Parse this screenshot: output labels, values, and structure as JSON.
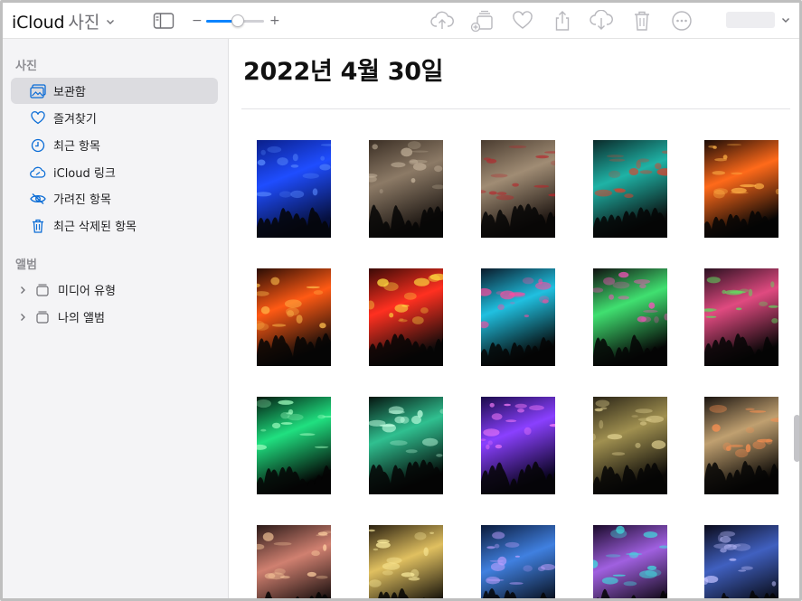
{
  "app": {
    "brand": "iCloud",
    "product": "사진"
  },
  "toolbar": {
    "zoom_minus": "−",
    "zoom_plus": "+",
    "zoom_level": 0.55,
    "icons": [
      "sidebar-toggle-icon",
      "upload-icon",
      "add-to-album-icon",
      "favorite-icon",
      "share-icon",
      "download-icon",
      "trash-icon",
      "more-icon"
    ]
  },
  "sidebar": {
    "photos_header": "사진",
    "items": [
      {
        "label": "보관함",
        "icon": "library-icon",
        "active": true
      },
      {
        "label": "즐겨찾기",
        "icon": "heart-icon",
        "active": false
      },
      {
        "label": "최근 항목",
        "icon": "clock-icon",
        "active": false
      },
      {
        "label": "iCloud 링크",
        "icon": "link-icon",
        "active": false
      },
      {
        "label": "가려진 항목",
        "icon": "eye-slash-icon",
        "active": false
      },
      {
        "label": "최근 삭제된 항목",
        "icon": "trash-icon",
        "active": false
      }
    ],
    "albums_header": "앨범",
    "albums": [
      {
        "label": "미디어 유형"
      },
      {
        "label": "나의 앨범"
      }
    ]
  },
  "main": {
    "date_title": "2022년 4월 30일",
    "photos": [
      {
        "scene": "blue-light-tunnel"
      },
      {
        "scene": "cave-interior"
      },
      {
        "scene": "cave-interior-red-seats"
      },
      {
        "scene": "cave-projection-teal-red"
      },
      {
        "scene": "cave-projection-orange-lava"
      },
      {
        "scene": "cave-projection-orange-red"
      },
      {
        "scene": "cave-projection-red-yellow"
      },
      {
        "scene": "cave-projection-colorful"
      },
      {
        "scene": "cave-projection-rainbow"
      },
      {
        "scene": "cave-projection-multicolor"
      },
      {
        "scene": "green-fireworks-projection"
      },
      {
        "scene": "green-light-lines"
      },
      {
        "scene": "purple-neon-corridor"
      },
      {
        "scene": "cave-tunnel-visitors"
      },
      {
        "scene": "lit-staircase"
      },
      {
        "scene": "arched-cave-lights"
      },
      {
        "scene": "arched-cave-yellow"
      },
      {
        "scene": "blue-cave-walkway"
      },
      {
        "scene": "purple-cave-walkway"
      },
      {
        "scene": "dark-cave-visitor"
      }
    ]
  }
}
